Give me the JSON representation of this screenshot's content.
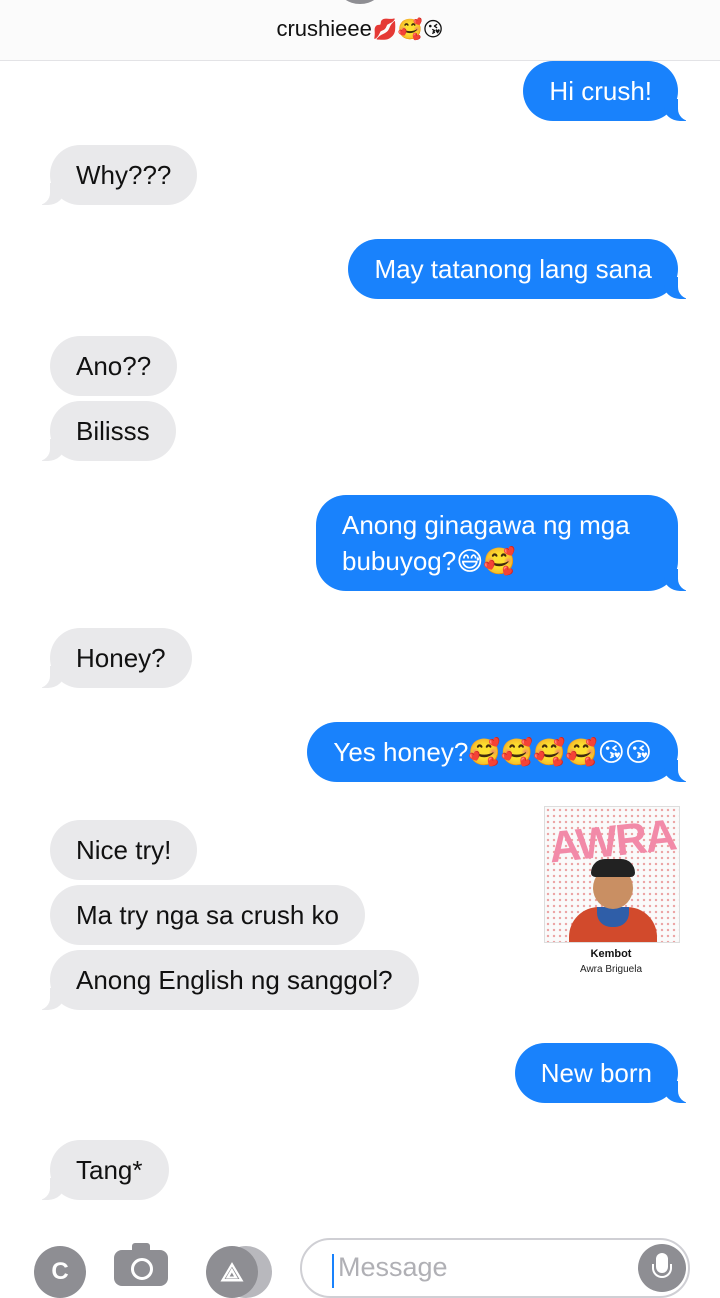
{
  "header": {
    "contact_name": "crushieee",
    "contact_emojis": "💋🥰😘"
  },
  "messages": [
    {
      "direction": "outgoing",
      "text": "Hi crush!"
    },
    {
      "direction": "incoming",
      "text": "Why???"
    },
    {
      "direction": "outgoing",
      "text": "May tatanong lang sana"
    },
    {
      "direction": "incoming",
      "text": "Ano??"
    },
    {
      "direction": "incoming",
      "text": "Bilisss"
    },
    {
      "direction": "outgoing",
      "text": "Anong ginagawa ng mga bubuyog?😅🥰"
    },
    {
      "direction": "incoming",
      "text": "Honey?"
    },
    {
      "direction": "outgoing",
      "text": "Yes honey?🥰🥰🥰🥰😘😘"
    },
    {
      "direction": "incoming",
      "text": "Nice try!"
    },
    {
      "direction": "incoming",
      "text": "Ma try nga sa crush ko"
    },
    {
      "direction": "incoming",
      "text": "Anong English ng sanggol?"
    },
    {
      "direction": "outgoing",
      "text": "New born"
    },
    {
      "direction": "incoming",
      "text": "Tang*"
    }
  ],
  "sticker": {
    "art_text": "AWRA",
    "title": "Kembot",
    "artist": "Awra Briguela"
  },
  "composer": {
    "placeholder": "Message",
    "app_button_letter": "C"
  },
  "colors": {
    "outgoing_bubble": "#1982fc",
    "incoming_bubble": "#e9e9eb",
    "icon_gray": "#8e8e93"
  }
}
